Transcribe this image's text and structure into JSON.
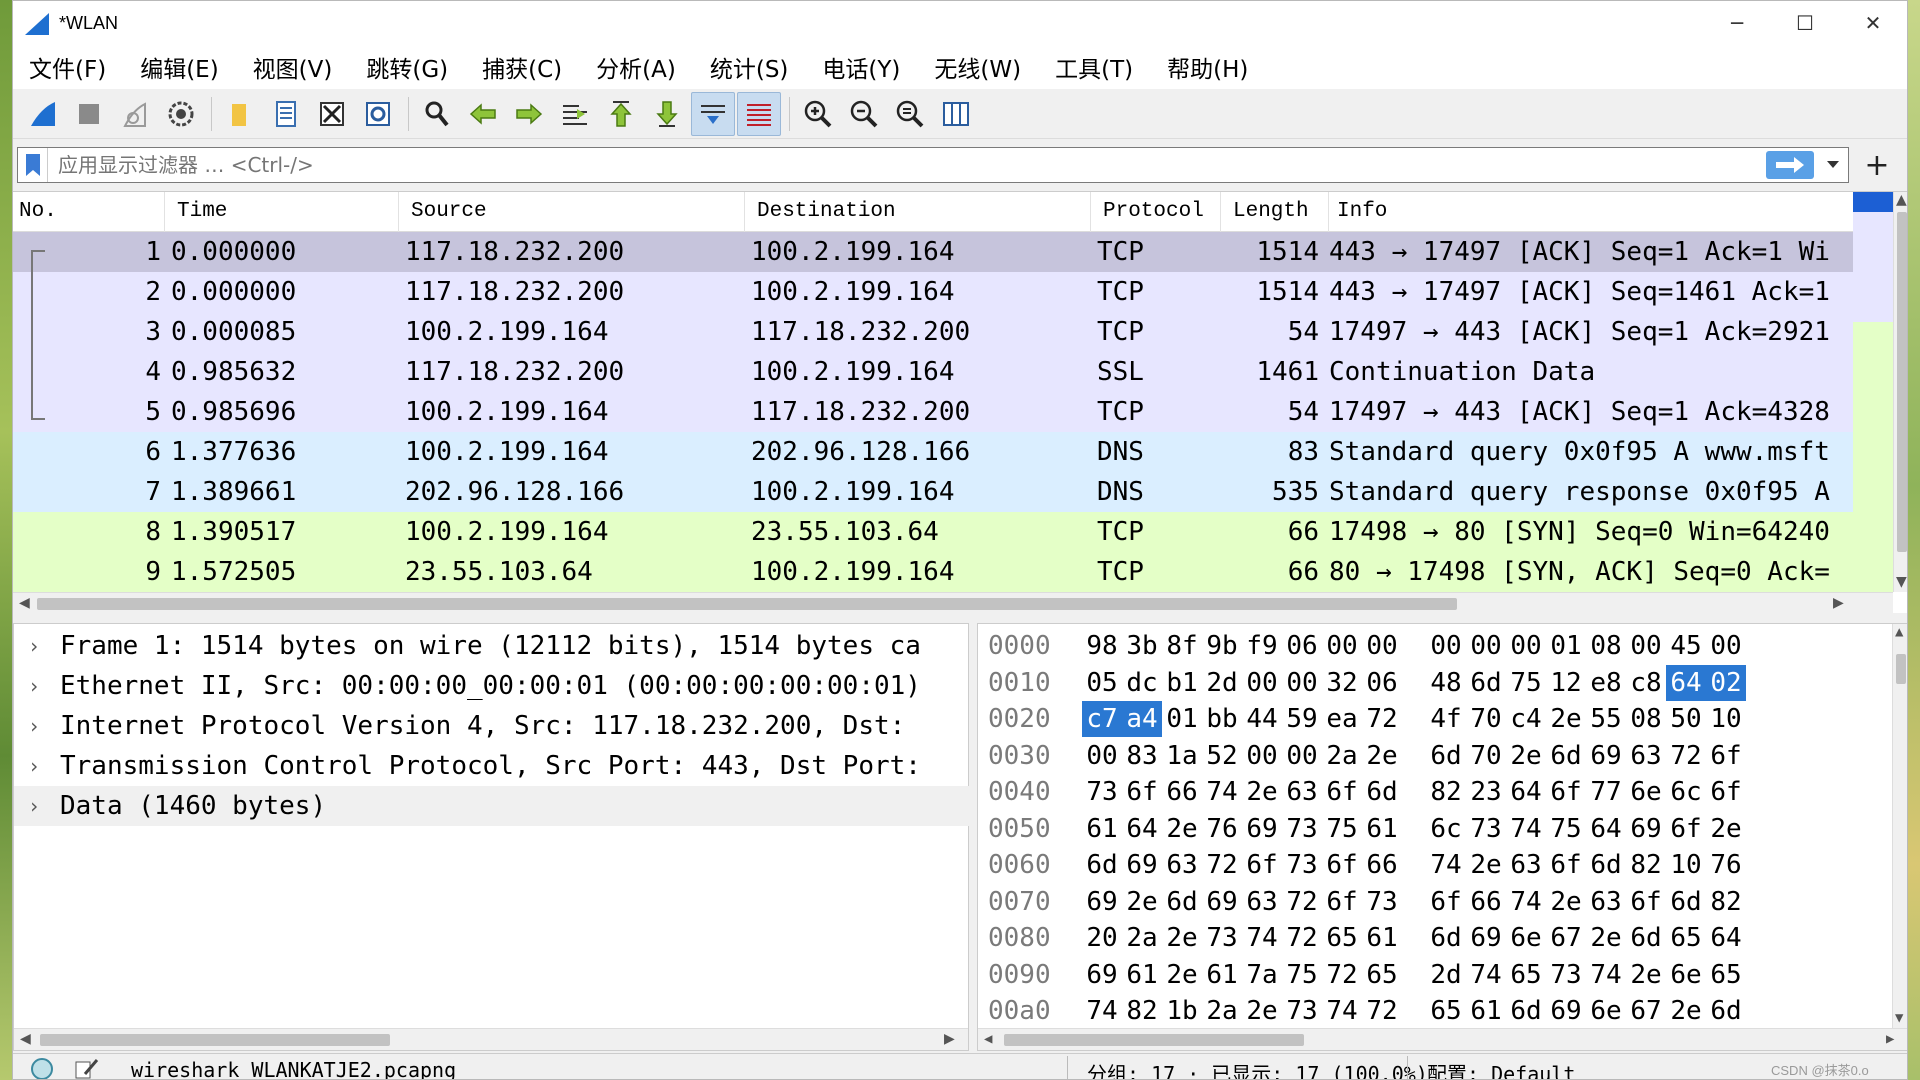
{
  "window": {
    "title": "*WLAN",
    "minimize": "─",
    "maximize": "☐",
    "close": "✕"
  },
  "menu": [
    "文件(F)",
    "编辑(E)",
    "视图(V)",
    "跳转(G)",
    "捕获(C)",
    "分析(A)",
    "统计(S)",
    "电话(Y)",
    "无线(W)",
    "工具(T)",
    "帮助(H)"
  ],
  "filter": {
    "placeholder": "应用显示过滤器 … <Ctrl-/>"
  },
  "packet_list": {
    "columns": [
      "No.",
      "Time",
      "Source",
      "Destination",
      "Protocol",
      "Length",
      "Info"
    ],
    "rows": [
      {
        "no": "1",
        "time": "0.000000",
        "src": "117.18.232.200",
        "dst": "100.2.199.164",
        "proto": "TCP",
        "len": "1514",
        "info": "443 → 17497 [ACK] Seq=1 Ack=1 Wi",
        "bg": "#c6c4dc"
      },
      {
        "no": "2",
        "time": "0.000000",
        "src": "117.18.232.200",
        "dst": "100.2.199.164",
        "proto": "TCP",
        "len": "1514",
        "info": "443 → 17497 [ACK] Seq=1461 Ack=1",
        "bg": "#e7e6ff"
      },
      {
        "no": "3",
        "time": "0.000085",
        "src": "100.2.199.164",
        "dst": "117.18.232.200",
        "proto": "TCP",
        "len": "54",
        "info": "17497 → 443 [ACK] Seq=1 Ack=2921",
        "bg": "#e7e6ff"
      },
      {
        "no": "4",
        "time": "0.985632",
        "src": "117.18.232.200",
        "dst": "100.2.199.164",
        "proto": "SSL",
        "len": "1461",
        "info": "Continuation Data",
        "bg": "#e7e6ff"
      },
      {
        "no": "5",
        "time": "0.985696",
        "src": "100.2.199.164",
        "dst": "117.18.232.200",
        "proto": "TCP",
        "len": "54",
        "info": "17497 → 443 [ACK] Seq=1 Ack=4328",
        "bg": "#e7e6ff"
      },
      {
        "no": "6",
        "time": "1.377636",
        "src": "100.2.199.164",
        "dst": "202.96.128.166",
        "proto": "DNS",
        "len": "83",
        "info": "Standard query 0x0f95 A www.msft",
        "bg": "#daeeff"
      },
      {
        "no": "7",
        "time": "1.389661",
        "src": "202.96.128.166",
        "dst": "100.2.199.164",
        "proto": "DNS",
        "len": "535",
        "info": "Standard query response 0x0f95 A",
        "bg": "#daeeff"
      },
      {
        "no": "8",
        "time": "1.390517",
        "src": "100.2.199.164",
        "dst": "23.55.103.64",
        "proto": "TCP",
        "len": "66",
        "info": "17498 → 80 [SYN] Seq=0 Win=64240",
        "bg": "#e4ffc7"
      },
      {
        "no": "9",
        "time": "1.572505",
        "src": "23.55.103.64",
        "dst": "100.2.199.164",
        "proto": "TCP",
        "len": "66",
        "info": "80 → 17498 [SYN, ACK] Seq=0 Ack=",
        "bg": "#e4ffc7"
      }
    ]
  },
  "details": [
    "Frame 1: 1514 bytes on wire (12112 bits), 1514 bytes ca",
    "Ethernet II, Src: 00:00:00_00:00:01 (00:00:00:00:00:01)",
    "Internet Protocol Version 4, Src: 117.18.232.200, Dst:",
    "Transmission Control Protocol, Src Port: 443, Dst Port:",
    "Data (1460 bytes)"
  ],
  "hex": [
    {
      "off": "0000",
      "bytes": [
        "98",
        "3b",
        "8f",
        "9b",
        "f9",
        "06",
        "00",
        "00",
        "00",
        "00",
        "00",
        "01",
        "08",
        "00",
        "45",
        "00"
      ]
    },
    {
      "off": "0010",
      "bytes": [
        "05",
        "dc",
        "b1",
        "2d",
        "00",
        "00",
        "32",
        "06",
        "48",
        "6d",
        "75",
        "12",
        "e8",
        "c8",
        "64",
        "02"
      ]
    },
    {
      "off": "0020",
      "bytes": [
        "c7",
        "a4",
        "01",
        "bb",
        "44",
        "59",
        "ea",
        "72",
        "4f",
        "70",
        "c4",
        "2e",
        "55",
        "08",
        "50",
        "10"
      ]
    },
    {
      "off": "0030",
      "bytes": [
        "00",
        "83",
        "1a",
        "52",
        "00",
        "00",
        "2a",
        "2e",
        "6d",
        "70",
        "2e",
        "6d",
        "69",
        "63",
        "72",
        "6f"
      ]
    },
    {
      "off": "0040",
      "bytes": [
        "73",
        "6f",
        "66",
        "74",
        "2e",
        "63",
        "6f",
        "6d",
        "82",
        "23",
        "64",
        "6f",
        "77",
        "6e",
        "6c",
        "6f"
      ]
    },
    {
      "off": "0050",
      "bytes": [
        "61",
        "64",
        "2e",
        "76",
        "69",
        "73",
        "75",
        "61",
        "6c",
        "73",
        "74",
        "75",
        "64",
        "69",
        "6f",
        "2e"
      ]
    },
    {
      "off": "0060",
      "bytes": [
        "6d",
        "69",
        "63",
        "72",
        "6f",
        "73",
        "6f",
        "66",
        "74",
        "2e",
        "63",
        "6f",
        "6d",
        "82",
        "10",
        "76"
      ]
    },
    {
      "off": "0070",
      "bytes": [
        "69",
        "2e",
        "6d",
        "69",
        "63",
        "72",
        "6f",
        "73",
        "6f",
        "66",
        "74",
        "2e",
        "63",
        "6f",
        "6d",
        "82"
      ]
    },
    {
      "off": "0080",
      "bytes": [
        "20",
        "2a",
        "2e",
        "73",
        "74",
        "72",
        "65",
        "61",
        "6d",
        "69",
        "6e",
        "67",
        "2e",
        "6d",
        "65",
        "64"
      ]
    },
    {
      "off": "0090",
      "bytes": [
        "69",
        "61",
        "2e",
        "61",
        "7a",
        "75",
        "72",
        "65",
        "2d",
        "74",
        "65",
        "73",
        "74",
        "2e",
        "6e",
        "65"
      ]
    },
    {
      "off": "00a0",
      "bytes": [
        "74",
        "82",
        "1b",
        "2a",
        "2e",
        "73",
        "74",
        "72",
        "65",
        "61",
        "6d",
        "69",
        "6e",
        "67",
        "2e",
        "6d"
      ]
    }
  ],
  "hex_highlight": [
    [
      1,
      14
    ],
    [
      1,
      15
    ],
    [
      2,
      0
    ],
    [
      2,
      1
    ]
  ],
  "status": {
    "file": "wireshark_WLANKATJE2.pcapng",
    "packets": "分组: 17 · 已显示: 17 (100.0%)",
    "profile": "配置: Default",
    "watermark": "CSDN @抹茶0.o"
  },
  "colors": {
    "accent": "#2a78d2",
    "apply": "#5aa0e6"
  }
}
